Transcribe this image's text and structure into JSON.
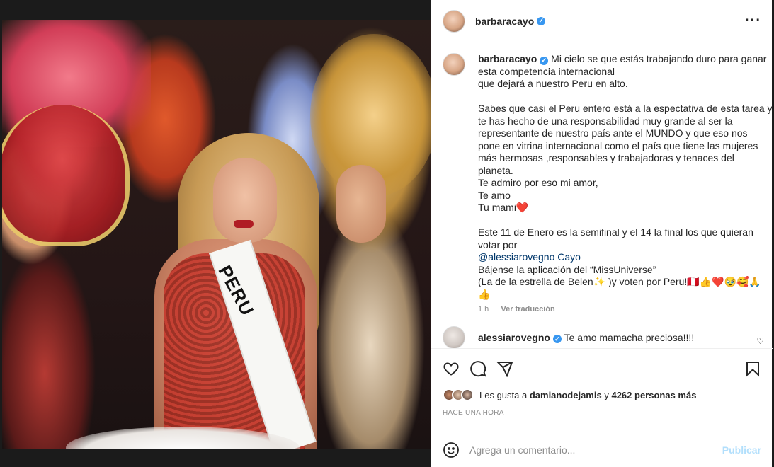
{
  "post": {
    "username": "barbaracayo",
    "more_icon": "more-horizontal-icon",
    "verified_icon": "verified-badge-icon"
  },
  "photo": {
    "sash_text": "PERU",
    "alt_description": ""
  },
  "caption": {
    "username": "barbaracayo",
    "lines": [
      "Mi cielo se que estás trabajando duro para ganar",
      "esta competencia internacional",
      "que dejará a nuestro Peru en alto.",
      "",
      "Sabes que casi el Peru entero está a la espectativa de esta tarea y",
      "te has hecho de una responsabilidad muy grande al ser la",
      "representante de nuestro país ante el MUNDO y que eso nos",
      "pone en vitrina internacional como el país que tiene las mujeres",
      "más hermosas ,responsables y trabajadoras y tenaces del",
      "planeta.",
      "Te admiro por eso mi amor,",
      "Te amo",
      "Tu mami❤️",
      "",
      "Este 11 de Enero es la semifinal y el 14 la final los que quieran",
      "votar por",
      "@alessiarovegno Cayo",
      "Bájense la aplicación del “MissUniverse”",
      "(La de la estrella de Belen✨ )y voten por Peru!🇵🇪👍❤️🥹🥰🙏",
      "👍"
    ],
    "time": "1 h",
    "translate": "Ver traducción"
  },
  "reply": {
    "username": "alessiarovegno",
    "text": "Te amo mamacha preciosa!!!!"
  },
  "actions": {
    "like_icon": "heart-icon",
    "comment_icon": "comment-icon",
    "share_icon": "share-icon",
    "save_icon": "bookmark-icon"
  },
  "likes": {
    "prefix": "Les gusta a",
    "user": "damianodejamis",
    "joiner": "y",
    "count_text": "4262 personas más"
  },
  "timestamp": "Hace una hora",
  "comment_box": {
    "placeholder": "Agrega un comentario...",
    "publish": "Publicar"
  },
  "colors": {
    "verified": "#3897f0",
    "publish_disabled": "#b2dffc",
    "mention": "#00376b"
  }
}
